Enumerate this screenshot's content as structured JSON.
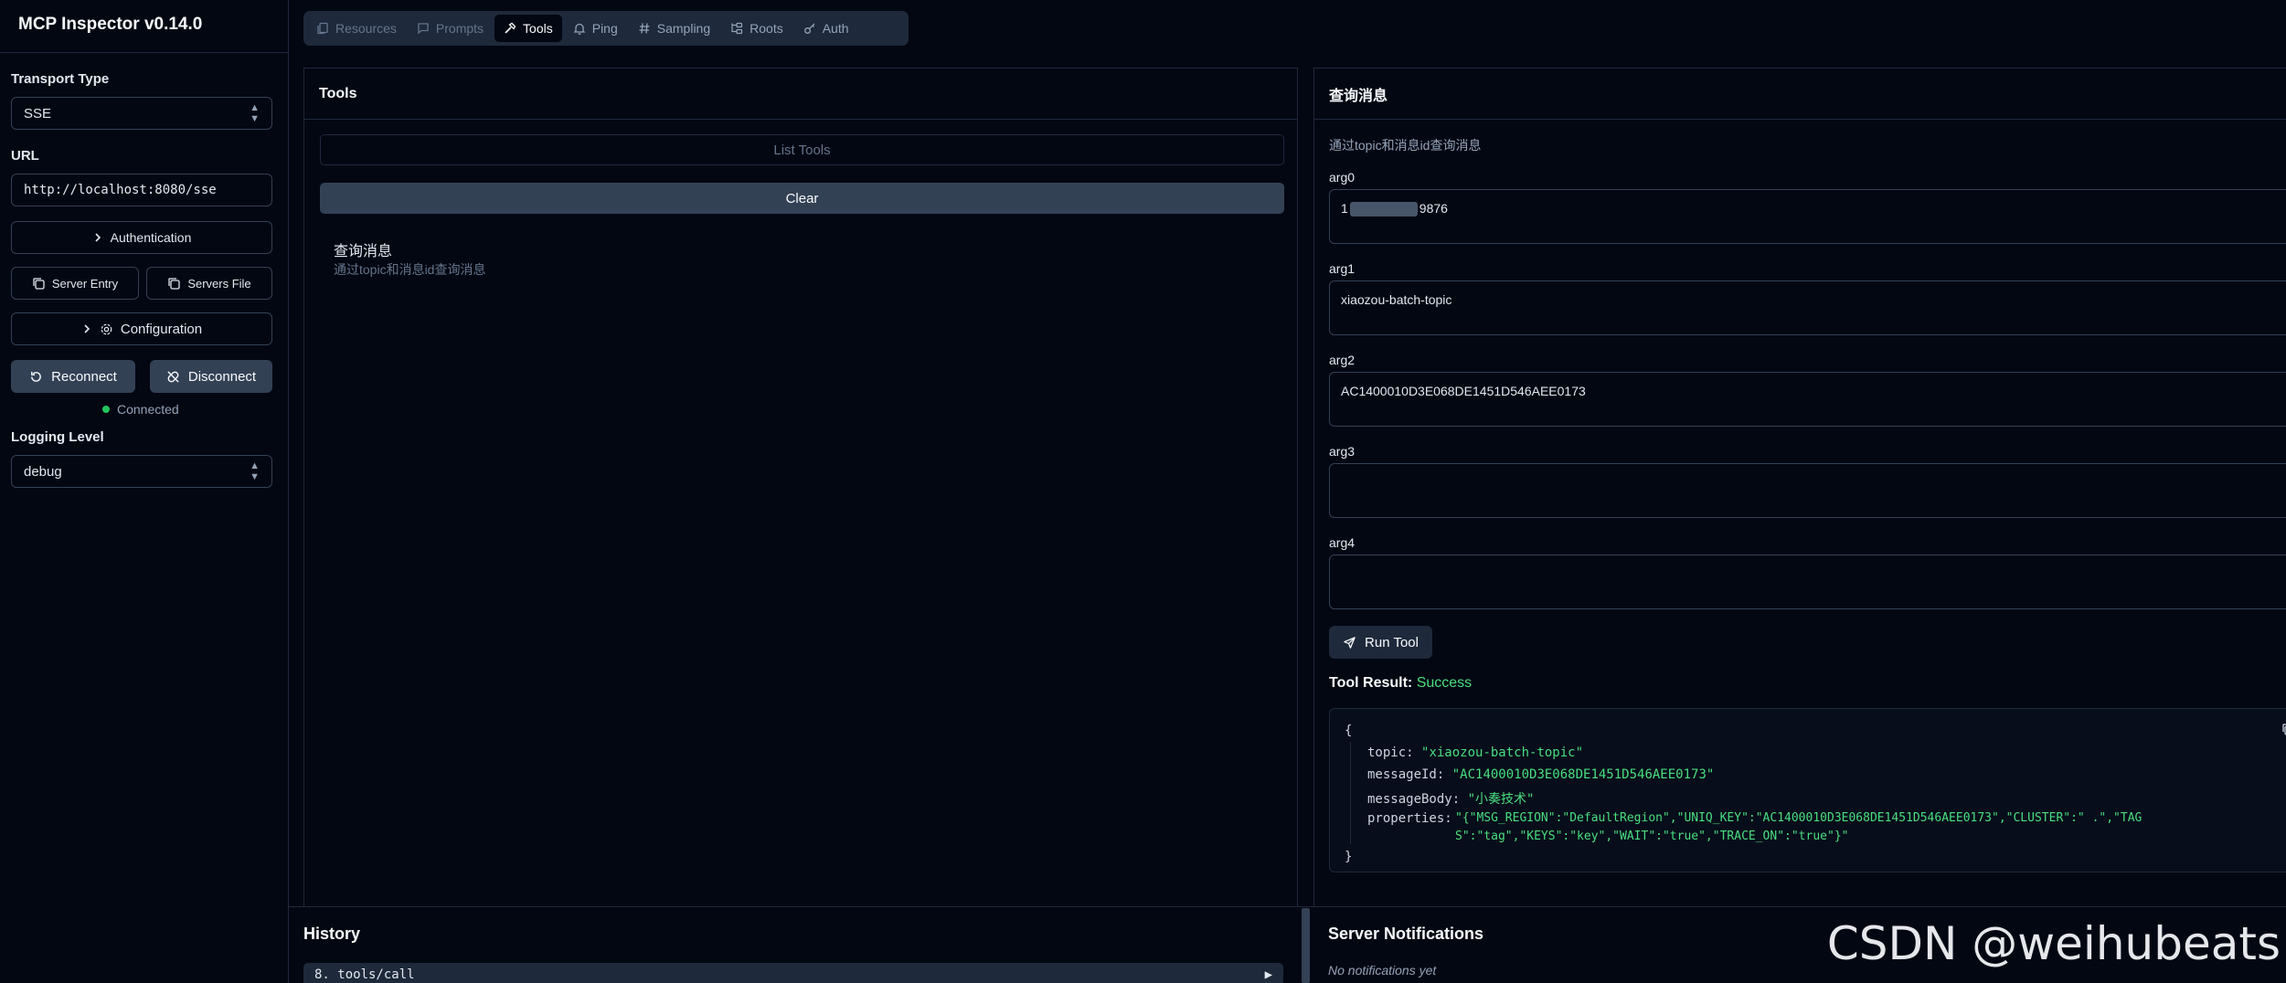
{
  "app": {
    "title": "MCP Inspector v0.14.0"
  },
  "sidebar": {
    "transport_label": "Transport Type",
    "transport_value": "SSE",
    "url_label": "URL",
    "url_value": "http://localhost:8080/sse",
    "authentication_label": "Authentication",
    "server_entry_label": "Server Entry",
    "servers_file_label": "Servers File",
    "configuration_label": "Configuration",
    "reconnect_label": "Reconnect",
    "disconnect_label": "Disconnect",
    "status_text": "Connected",
    "status_color": "#22c55e",
    "logging_label": "Logging Level",
    "logging_value": "debug"
  },
  "tabs": [
    {
      "label": "Resources",
      "icon": "files-icon"
    },
    {
      "label": "Prompts",
      "icon": "message-icon"
    },
    {
      "label": "Tools",
      "icon": "hammer-icon",
      "active": true
    },
    {
      "label": "Ping",
      "icon": "bell-icon"
    },
    {
      "label": "Sampling",
      "icon": "hash-icon"
    },
    {
      "label": "Roots",
      "icon": "folder-tree-icon"
    },
    {
      "label": "Auth",
      "icon": "key-icon"
    }
  ],
  "tools_panel": {
    "title": "Tools",
    "list_tools_label": "List Tools",
    "clear_label": "Clear",
    "tool_name": "查询消息",
    "tool_desc": "通过topic和消息id查询消息"
  },
  "detail_panel": {
    "title": "查询消息",
    "description": "通过topic和消息id查询消息",
    "args": [
      {
        "label": "arg0",
        "value_prefix": "1",
        "value_suffix": "9876"
      },
      {
        "label": "arg1",
        "value": "xiaozou-batch-topic"
      },
      {
        "label": "arg2",
        "value": "AC1400010D3E068DE1451D546AEE0173"
      },
      {
        "label": "arg3",
        "value": ""
      },
      {
        "label": "arg4",
        "value": ""
      }
    ],
    "run_label": "Run Tool",
    "result_label": "Tool Result:",
    "result_status": "Success",
    "result": {
      "open": "{",
      "close": "}",
      "topic_key": "topic:",
      "topic_val": "\"xiaozou-batch-topic\"",
      "messageId_key": "messageId:",
      "messageId_val": "\"AC1400010D3E068DE1451D546AEE0173\"",
      "messageBody_key": "messageBody:",
      "messageBody_val": "\"小奏技术\"",
      "properties_key": "properties:",
      "properties_line1": "\"{\"MSG_REGION\":\"DefaultRegion\",\"UNIQ_KEY\":\"AC1400010D3E068DE1451D546AEE0173\",\"CLUSTER\":\"         .\",\"TAG",
      "properties_line2": "S\":\"tag\",\"KEYS\":\"key\",\"WAIT\":\"true\",\"TRACE_ON\":\"true\"}\""
    }
  },
  "history": {
    "title": "History",
    "row_label": "8. tools/call",
    "row_arrow": "▶"
  },
  "notifications": {
    "title": "Server Notifications",
    "empty_text": "No notifications yet"
  },
  "watermark": "CSDN @weihubeats"
}
